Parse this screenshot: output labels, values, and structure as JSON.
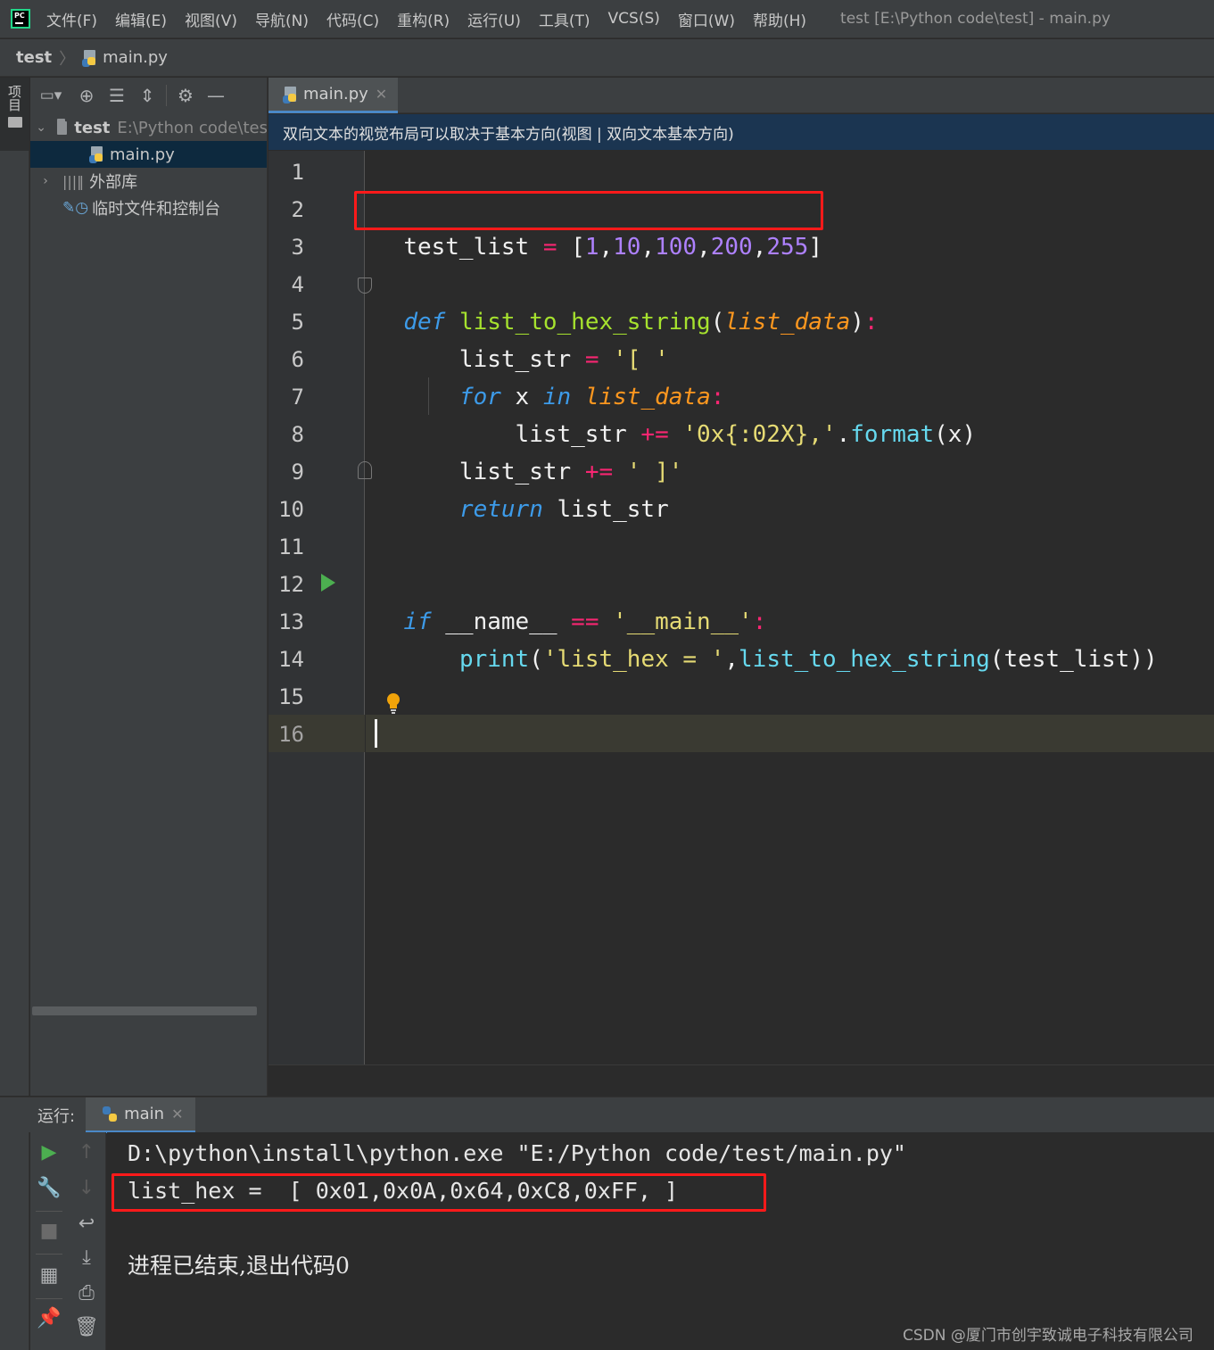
{
  "app": {
    "logo_text": "PC",
    "window_title": "test [E:\\Python code\\test] - main.py",
    "menu": [
      "文件(F)",
      "编辑(E)",
      "视图(V)",
      "导航(N)",
      "代码(C)",
      "重构(R)",
      "运行(U)",
      "工具(T)",
      "VCS(S)",
      "窗口(W)",
      "帮助(H)"
    ]
  },
  "breadcrumb": {
    "project": "test",
    "file": "main.py"
  },
  "left_stripe": {
    "project_label": "项目"
  },
  "project_panel": {
    "toolbar_icons": [
      "project-view-icon",
      "locate-icon",
      "expand-all-icon",
      "collapse-all-icon",
      "gear-icon",
      "hide-icon"
    ],
    "tree": {
      "root_name": "test",
      "root_path": "E:\\Python code\\tes",
      "file": "main.py",
      "external_libs": "外部库",
      "scratches": "临时文件和控制台"
    }
  },
  "editor": {
    "tab_label": "main.py",
    "banner": "双向文本的视觉布局可以取决于基本方向(视图 | 双向文本基本方向)",
    "line_numbers": [
      "1",
      "2",
      "3",
      "4",
      "5",
      "6",
      "7",
      "8",
      "9",
      "10",
      "11",
      "12",
      "13",
      "14",
      "15",
      "16"
    ],
    "current_line": 16,
    "code": {
      "l2": [
        "test_list",
        " ",
        "=",
        " [",
        "1",
        ",",
        "10",
        ",",
        "100",
        ",",
        "200",
        ",",
        "255",
        "]"
      ],
      "l4": [
        "def",
        " ",
        "list_to_hex_string",
        "(",
        "list_data",
        ")",
        ":"
      ],
      "l5": [
        "    list_str ",
        "=",
        " ",
        "'[ '"
      ],
      "l6": [
        "    ",
        "for",
        " x ",
        "in",
        " ",
        "list_data",
        ":"
      ],
      "l7": [
        "        list_str ",
        "+=",
        " ",
        "'0x{:02X},'",
        ".",
        "format",
        "(x)"
      ],
      "l8": [
        "    list_str ",
        "+=",
        " ",
        "' ]'"
      ],
      "l9": [
        "    ",
        "return",
        " list_str"
      ],
      "l12": [
        "if",
        " __name__ ",
        "==",
        " ",
        "'__main__'",
        ":"
      ],
      "l13": [
        "    ",
        "print",
        "(",
        "'list_hex = '",
        ",",
        "list_to_hex_string",
        "(test_list))"
      ]
    }
  },
  "run_panel": {
    "label": "运行:",
    "tab_label": "main",
    "console": [
      "D:\\python\\install\\python.exe \"E:/Python code/test/main.py\"",
      "list_hex =  [ 0x01,0x0A,0x64,0xC8,0xFF, ]",
      "",
      "进程已结束,退出代码0"
    ]
  },
  "watermark": "CSDN @厦门市创宇致诚电子科技有限公司",
  "colors": {
    "keyword": "#3d9be9",
    "function": "#a6e22e",
    "parameter": "#fd971f",
    "number": "#ae81ff",
    "string": "#e6db74",
    "operator": "#f92672",
    "highlight_box": "#ff1a1a",
    "accent": "#4a88c7"
  }
}
